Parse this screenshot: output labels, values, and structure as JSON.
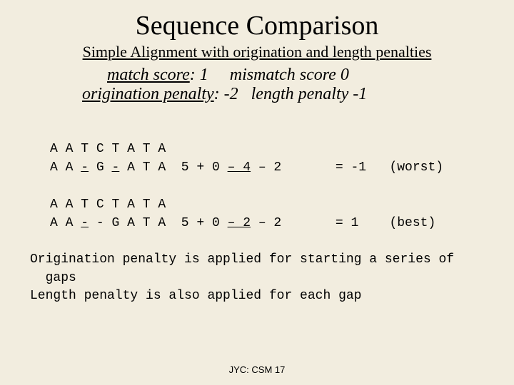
{
  "title": "Sequence Comparison",
  "subtitle": "Simple Alignment with origination and length penalties",
  "params": {
    "match_label": "match score",
    "match_value": ": 1",
    "mismatch_label": "mismatch score",
    "mismatch_value": " 0",
    "orig_label": "origination penalty",
    "orig_value": ": -2",
    "len_label": "length penalty",
    "len_value": " -1"
  },
  "align1": {
    "row1": {
      "c0": "A",
      "c1": "A",
      "c2": "T",
      "c3": "C",
      "c4": "T",
      "c5": "A",
      "c6": "T",
      "c7": "A"
    },
    "row2": {
      "c0": "A",
      "c1": "A",
      "c2": "-",
      "c3": "G",
      "c4": "-",
      "c5": "A",
      "c6": "T",
      "c7": "A"
    },
    "calc": {
      "pre": "5 + 0 ",
      "mid": "– 4",
      "post": " – 2       = -1   (worst)"
    }
  },
  "align2": {
    "row1": {
      "c0": "A",
      "c1": "A",
      "c2": "T",
      "c3": "C",
      "c4": "T",
      "c5": "A",
      "c6": "T",
      "c7": "A"
    },
    "row2": {
      "c0": "A",
      "c1": "A",
      "c2": "-",
      "c3": "-",
      "c4": "G",
      "c5": "A",
      "c6": "T",
      "c7": "A"
    },
    "calc": {
      "pre": "5 + 0 ",
      "mid": "– 2",
      "post": " – 2       = 1    (best)"
    }
  },
  "explain": {
    "l1": "Origination penalty is applied for starting a series of",
    "l2": "  gaps",
    "l3": "Length penalty is also applied for each gap"
  },
  "footer": "JYC: CSM 17"
}
